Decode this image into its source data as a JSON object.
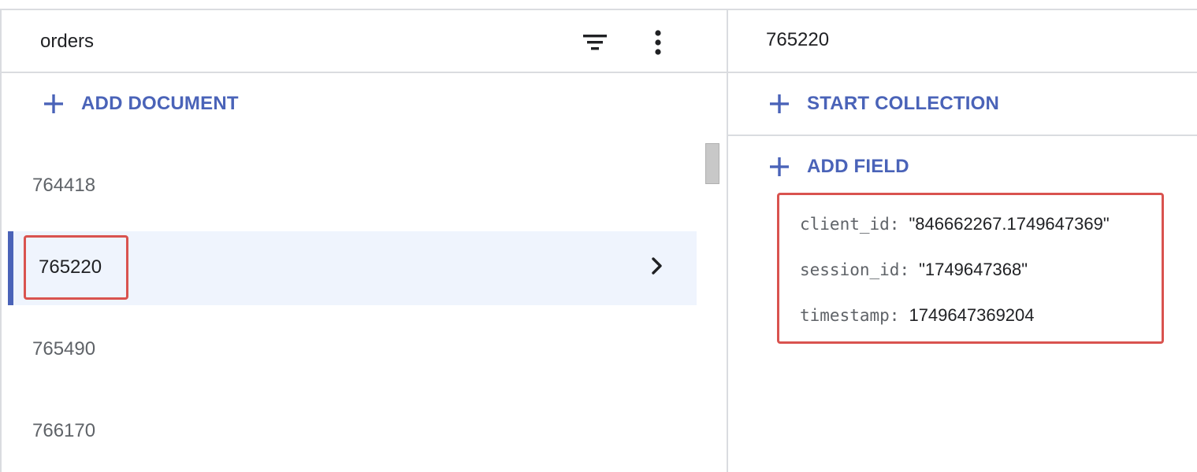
{
  "left_panel": {
    "collection_title": "orders",
    "add_document_label": "ADD DOCUMENT",
    "documents": [
      {
        "id": "764418"
      },
      {
        "id": "765220",
        "selected": true
      },
      {
        "id": "765490"
      },
      {
        "id": "766170"
      }
    ]
  },
  "right_panel": {
    "document_title": "765220",
    "start_collection_label": "START COLLECTION",
    "add_field_label": "ADD FIELD",
    "fields": [
      {
        "key": "client_id",
        "value": "\"846662267.1749647369\""
      },
      {
        "key": "session_id",
        "value": "\"1749647368\""
      },
      {
        "key": "timestamp",
        "value": "1749647369204"
      }
    ]
  },
  "colors": {
    "accent": "#4a63b8",
    "highlight": "#d9534f",
    "selected_bg": "#eff4fd",
    "divider": "#dadce0"
  },
  "icons": [
    "filter-icon",
    "more-vert-icon",
    "plus-icon",
    "chevron-right-icon"
  ]
}
